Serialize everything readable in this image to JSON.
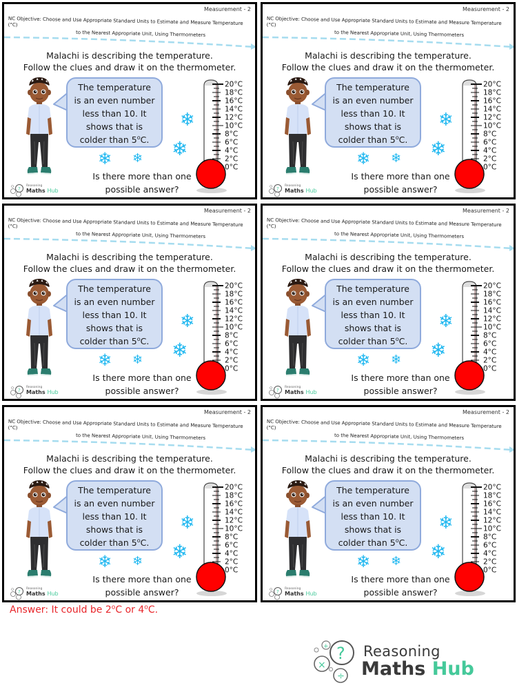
{
  "worksheet": {
    "strand": "Measurement - 2",
    "objective_line1": "NC Objective: Choose and Use Appropriate Standard Units to Estimate and Measure Temperature (°C)",
    "objective_line2": "to the Nearest Appropriate Unit, Using Thermometers",
    "instruction_line1": "Malachi is describing the temperature.",
    "instruction_line2": "Follow the clues and draw it on the thermometer.",
    "character_name": "Malachi",
    "speech_lines": [
      "The temperature",
      "is an even number",
      "less than 10. It",
      "shows that is",
      "colder than 5"
    ],
    "speech_degree_suffix": "C.",
    "question_line1": "Is there more than one",
    "question_line2": "possible answer?",
    "snowflake_glyph": "❄",
    "thermometer": {
      "scale_labels": [
        "20°C",
        "18°C",
        "16°C",
        "14°C",
        "12°C",
        "10°C",
        "8°C",
        "6°C",
        "4°C",
        "2°C",
        "0°C"
      ],
      "min": 0,
      "max": 20,
      "bulb_color": "#ff0000"
    },
    "mini_logo": {
      "line1": "Reasoning",
      "line2a": "Maths",
      "line2b": "Hub"
    }
  },
  "panels": [
    {
      "id": 1
    },
    {
      "id": 2
    },
    {
      "id": 3
    },
    {
      "id": 4
    },
    {
      "id": 5
    },
    {
      "id": 6
    }
  ],
  "answer": {
    "prefix": "Answer: It could be 2",
    "mid": "C or 4",
    "suffix": "C.",
    "degree": "o",
    "color": "#e8262b"
  },
  "logo": {
    "line1": "Reasoning",
    "line2a": "Maths",
    "line2b": "Hub",
    "accent": "#45c99a"
  }
}
